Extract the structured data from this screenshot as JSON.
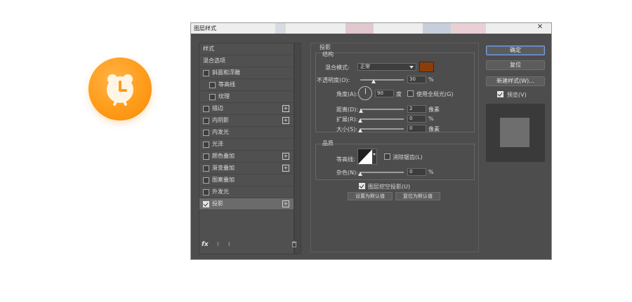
{
  "app_icon": {
    "name": "alarm-clock-icon",
    "color": "#ff9c1a"
  },
  "window": {
    "title": "图层样式",
    "close_glyph": "✕"
  },
  "styles_panel": {
    "header": "样式",
    "items": [
      {
        "label": "混合选项",
        "checkbox": false,
        "checked": false,
        "plus": false,
        "indent": 0
      },
      {
        "label": "斜面和浮雕",
        "checkbox": true,
        "checked": false,
        "plus": false,
        "indent": 0
      },
      {
        "label": "等高线",
        "checkbox": true,
        "checked": false,
        "plus": false,
        "indent": 1
      },
      {
        "label": "纹理",
        "checkbox": true,
        "checked": false,
        "plus": false,
        "indent": 1
      },
      {
        "label": "描边",
        "checkbox": true,
        "checked": false,
        "plus": true,
        "indent": 0
      },
      {
        "label": "内阴影",
        "checkbox": true,
        "checked": false,
        "plus": true,
        "indent": 0
      },
      {
        "label": "内发光",
        "checkbox": true,
        "checked": false,
        "plus": false,
        "indent": 0
      },
      {
        "label": "光泽",
        "checkbox": true,
        "checked": false,
        "plus": false,
        "indent": 0
      },
      {
        "label": "颜色叠加",
        "checkbox": true,
        "checked": false,
        "plus": true,
        "indent": 0
      },
      {
        "label": "渐变叠加",
        "checkbox": true,
        "checked": false,
        "plus": true,
        "indent": 0
      },
      {
        "label": "图案叠加",
        "checkbox": true,
        "checked": false,
        "plus": false,
        "indent": 0
      },
      {
        "label": "外发光",
        "checkbox": true,
        "checked": false,
        "plus": false,
        "indent": 0
      },
      {
        "label": "投影",
        "checkbox": true,
        "checked": true,
        "plus": true,
        "indent": 0,
        "selected": true
      }
    ],
    "footer": {
      "fx": "fx",
      "up": "⬆",
      "down": "⬇",
      "trash": "🗑"
    }
  },
  "drop_shadow": {
    "section_title": "投影",
    "structure_title": "结构",
    "blend_mode_label": "混合模式:",
    "blend_mode_value": "正常",
    "shadow_color": "#8b3e0a",
    "opacity_label": "不透明度(O):",
    "opacity_value": "30",
    "opacity_fraction": 0.3,
    "percent": "%",
    "angle_label": "角度(A):",
    "angle_value": "90",
    "degree": "度",
    "global_light_label": "使用全局光(G)",
    "distance_label": "距离(D):",
    "distance_value": "2",
    "distance_fraction": 0.02,
    "pixels": "像素",
    "spread_label": "扩展(R):",
    "spread_value": "0",
    "size_label": "大小(S):",
    "size_value": "0",
    "quality_title": "品质",
    "contour_label": "等高线:",
    "anti_alias_label": "消除锯齿(L)",
    "noise_label": "杂色(N):",
    "noise_value": "0",
    "knockout_label": "图层挖空投影(U)",
    "make_default": "设置为默认值",
    "reset_default": "复位为默认值"
  },
  "actions": {
    "ok": "确定",
    "reset": "复位",
    "new_style": "新建样式(W)...",
    "preview_label": "预览(V)"
  }
}
